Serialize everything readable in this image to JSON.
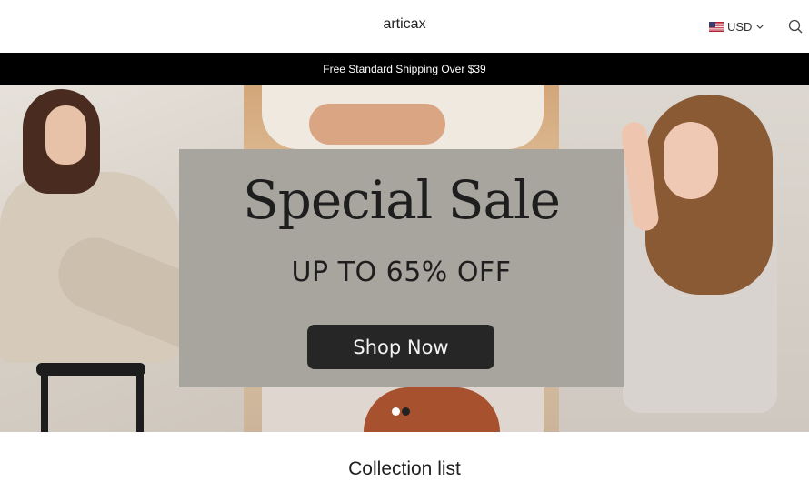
{
  "header": {
    "brand": "articax",
    "currency": "USD",
    "icons": {
      "currency_flag": "us-flag-icon",
      "chevron": "chevron-down-icon",
      "search": "search-icon"
    }
  },
  "announcement": {
    "text": "Free Standard Shipping Over $39",
    "background": "#000000",
    "color": "#ffffff"
  },
  "hero": {
    "title": "Special Sale",
    "subtitle": "UP TO 65% OFF",
    "button_label": "Shop Now",
    "card_color": "#a8a59e",
    "button_color": "#262626",
    "slides": [
      {
        "active": true
      },
      {
        "active": false
      }
    ]
  },
  "section": {
    "title": "Collection list"
  }
}
